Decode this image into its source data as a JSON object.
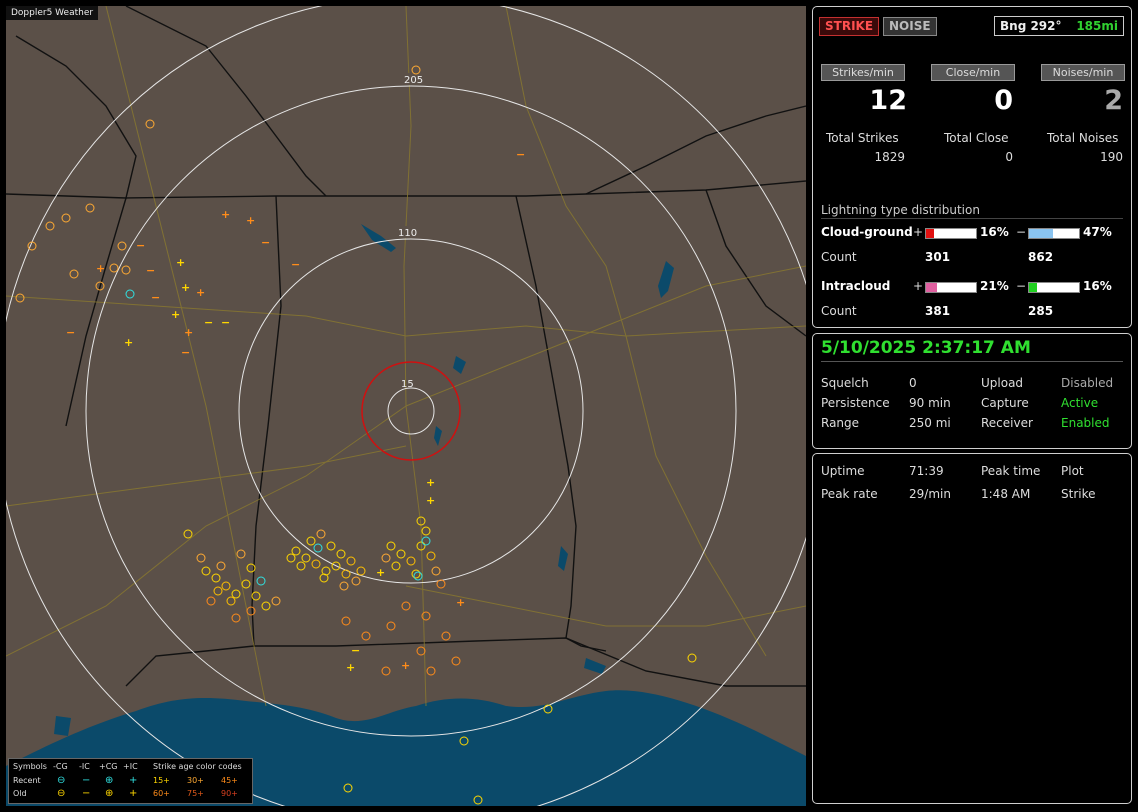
{
  "app": {
    "title": "Doppler5 Weather"
  },
  "map": {
    "range_labels": [
      "205",
      "110",
      "15"
    ],
    "colors": {
      "land": "#5b5048",
      "water": "#0b4a6a",
      "rings": "#e6e6e6",
      "close_ring": "#d01010",
      "roads": "#8b7a2e",
      "borders": "#111111"
    }
  },
  "legend": {
    "header": {
      "symbols": "Symbols",
      "cols": [
        "-CG",
        "-IC",
        "+CG",
        "+IC"
      ],
      "age_title": "Strike age color codes"
    },
    "recent_label": "Recent",
    "old_label": "Old",
    "recent_symbols": [
      "⊖",
      "−",
      "⊕",
      "+"
    ],
    "old_symbols": [
      "⊖",
      "−",
      "⊕",
      "+"
    ],
    "recent_ages": [
      "15+",
      "30+",
      "45+"
    ],
    "old_ages": [
      "60+",
      "75+",
      "90+"
    ]
  },
  "status": {
    "strike_button": "STRIKE",
    "noise_button": "NOISE",
    "bearing": "Bng 292°",
    "distance": "185mi",
    "rates": {
      "strikes_label": "Strikes/min",
      "strikes_value": "12",
      "close_label": "Close/min",
      "close_value": "0",
      "noises_label": "Noises/min",
      "noises_value": "2"
    },
    "totals": {
      "strikes_label": "Total Strikes",
      "strikes_value": "1829",
      "close_label": "Total Close",
      "close_value": "0",
      "noises_label": "Total Noises",
      "noises_value": "190"
    },
    "distribution": {
      "title": "Lightning type distribution",
      "cg_label": "Cloud-ground",
      "ic_label": "Intracloud",
      "count_label": "Count",
      "plus_sign": "+",
      "minus_sign": "−",
      "cg_plus_pct": "16%",
      "cg_plus_frac": 0.16,
      "cg_plus_color": "#e01010",
      "cg_minus_pct": "47%",
      "cg_minus_frac": 0.47,
      "cg_minus_color": "#8ac4f0",
      "cg_plus_count": "301",
      "cg_minus_count": "862",
      "ic_plus_pct": "21%",
      "ic_plus_frac": 0.21,
      "ic_plus_color": "#e060a0",
      "ic_minus_pct": "16%",
      "ic_minus_frac": 0.16,
      "ic_minus_color": "#20d020",
      "ic_plus_count": "381",
      "ic_minus_count": "285"
    }
  },
  "settings": {
    "datetime": "5/10/2025 2:37:17 AM",
    "squelch_label": "Squelch",
    "squelch_value": "0",
    "persistence_label": "Persistence",
    "persistence_value": "90 min",
    "range_label": "Range",
    "range_value": "250 mi",
    "upload_label": "Upload",
    "upload_value": "Disabled",
    "capture_label": "Capture",
    "capture_value": "Active",
    "receiver_label": "Receiver",
    "receiver_value": "Enabled"
  },
  "stats": {
    "uptime_label": "Uptime",
    "uptime_value": "71:39",
    "peak_time_label": "Peak time",
    "peak_time_value": "1:48 AM",
    "plot_label": "Plot",
    "plot_value": "Strike",
    "peak_rate_label": "Peak rate",
    "peak_rate_value": "29/min"
  }
}
